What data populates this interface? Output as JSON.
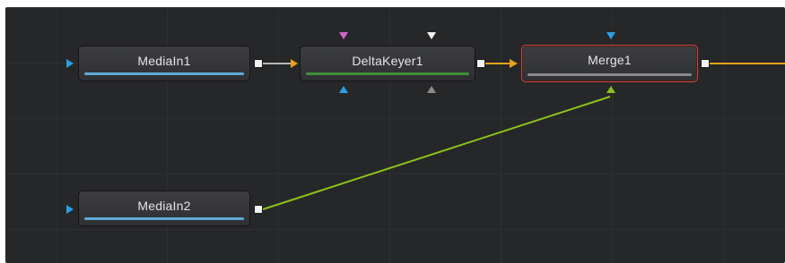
{
  "nodes": {
    "mediain1": {
      "label": "MediaIn1"
    },
    "deltakeyer1": {
      "label": "DeltaKeyer1"
    },
    "merge1": {
      "label": "Merge1"
    },
    "mediain2": {
      "label": "MediaIn2"
    }
  },
  "colors": {
    "background": "#262729",
    "media_bar": "#5fa9d6",
    "keyer_bar": "#3f8f3a",
    "merge_bar": "#8a8a8a",
    "wire_main": "#e6a21a",
    "wire_foreground": "#8cc21a",
    "wire_plain": "#e6e6e6",
    "port_blue": "#2b9ee6",
    "port_pink": "#d864c8",
    "port_white": "#f2f2f2",
    "port_gray": "#8c8c8c",
    "port_green": "#8cc21a",
    "selected_border": "#c8483c"
  }
}
